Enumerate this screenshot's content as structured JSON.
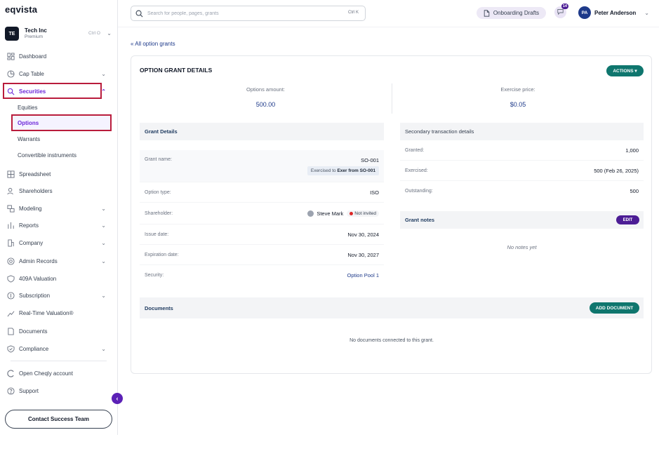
{
  "app": {
    "logo": "eqvista"
  },
  "company": {
    "initials": "TE",
    "name": "Tech Inc",
    "plan": "Premium",
    "shortcut": "Ctrl O"
  },
  "sidebar": {
    "items": [
      {
        "label": "Dashboard",
        "icon": "dashboard-icon"
      },
      {
        "label": "Cap Table",
        "icon": "pie-icon"
      },
      {
        "label": "Securities",
        "icon": "securities-icon"
      },
      {
        "label": "Spreadsheet",
        "icon": "grid-icon"
      },
      {
        "label": "Shareholders",
        "icon": "people-icon"
      },
      {
        "label": "Modeling",
        "icon": "modeling-icon"
      },
      {
        "label": "Reports",
        "icon": "reports-icon"
      },
      {
        "label": "Company",
        "icon": "company-icon"
      },
      {
        "label": "Admin Records",
        "icon": "admin-icon"
      },
      {
        "label": "409A Valuation",
        "icon": "shield-icon"
      },
      {
        "label": "Subscription",
        "icon": "dollar-icon"
      },
      {
        "label": "Real-Time Valuation®",
        "icon": "chart-icon"
      },
      {
        "label": "Documents",
        "icon": "document-icon"
      },
      {
        "label": "Compliance",
        "icon": "shield-check-icon"
      },
      {
        "label": "Open Cheqly account",
        "icon": "cheqly-icon"
      },
      {
        "label": "Support",
        "icon": "help-icon"
      }
    ],
    "securities_sub": [
      "Equities",
      "Options",
      "Warrants",
      "Convertible instruments"
    ],
    "contact_label": "Contact Success Team"
  },
  "header": {
    "search_placeholder": "Search for people, pages, grants",
    "search_shortcut": "Ctrl K",
    "onboarding_label": "Onboarding Drafts",
    "notification_count": "14",
    "user_initials": "PA",
    "user_name": "Peter Anderson"
  },
  "main": {
    "back_link": "« All option grants",
    "title": "OPTION GRANT DETAILS",
    "actions_label": "ACTIONS ▾",
    "options_amount_label": "Options amount:",
    "options_amount_value": "500.00",
    "exercise_price_label": "Exercise price:",
    "exercise_price_value": "$0.05",
    "grant_details": {
      "heading": "Grant Details",
      "grant_name_label": "Grant name:",
      "grant_name_value": "SO-001",
      "exercised_prefix": "Exercised to ",
      "exercised_bold": "Exer from SO-001",
      "option_type_label": "Option type:",
      "option_type_value": "ISO",
      "shareholder_label": "Shareholder:",
      "shareholder_value": "Steve Mark",
      "shareholder_status": "Not invited",
      "issue_date_label": "Issue date:",
      "issue_date_value": "Nov 30, 2024",
      "expiration_label": "Expiration date:",
      "expiration_value": "Nov 30, 2027",
      "security_label": "Security:",
      "security_value": "Option Pool 1"
    },
    "secondary": {
      "heading": "Secondary transaction details",
      "granted_label": "Granted:",
      "granted_value": "1,000",
      "exercised_label": "Exercised:",
      "exercised_value": "500 (Feb 26, 2025)",
      "outstanding_label": "Outstanding:",
      "outstanding_value": "500"
    },
    "notes": {
      "heading": "Grant notes",
      "edit_label": "EDIT",
      "empty": "No notes yet"
    },
    "documents": {
      "heading": "Documents",
      "add_label": "ADD DOCUMENT",
      "empty": "No documents connected to this grant."
    }
  },
  "colors": {
    "accent": "#6d28d9",
    "teal": "#0f766e",
    "highlight": "#b91c3c",
    "navy": "#1e3a8a"
  }
}
